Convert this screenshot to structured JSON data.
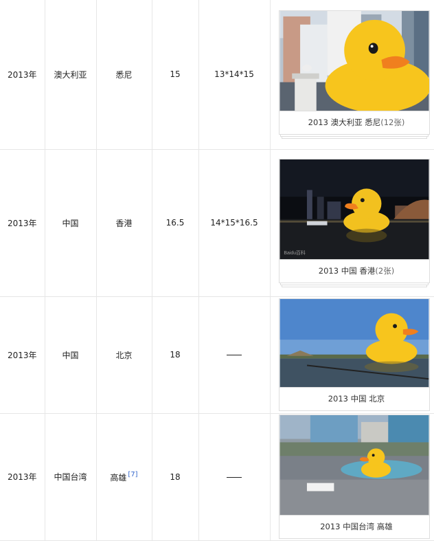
{
  "rows": [
    {
      "year": "2013年",
      "country": "澳大利亚",
      "city": "悉尼",
      "ref": "",
      "height": "15",
      "size": "13*14*15",
      "caption": {
        "year": "2013",
        "country": "澳大利亚",
        "city": "悉尼",
        "count": "(12张)"
      }
    },
    {
      "year": "2013年",
      "country": "中国",
      "city": "香港",
      "ref": "",
      "height": "16.5",
      "size": "14*15*16.5",
      "caption": {
        "year": "2013",
        "country": "中国",
        "city": "香港",
        "count": "(2张)"
      },
      "watermark": "Baidu百科"
    },
    {
      "year": "2013年",
      "country": "中国",
      "city": "北京",
      "ref": "",
      "height": "18",
      "size": "——",
      "caption": {
        "year": "2013",
        "country": "中国",
        "city": "北京",
        "count": ""
      }
    },
    {
      "year": "2013年",
      "country": "中国台湾",
      "city": "高雄",
      "ref": "[7]",
      "height": "18",
      "size": "——",
      "caption": {
        "year": "2013",
        "country": "中国台湾",
        "city": "高雄",
        "count": ""
      }
    }
  ],
  "colors": {
    "duck": "#f7c51d",
    "beak": "#f07f1e",
    "link": "#3366cc"
  }
}
